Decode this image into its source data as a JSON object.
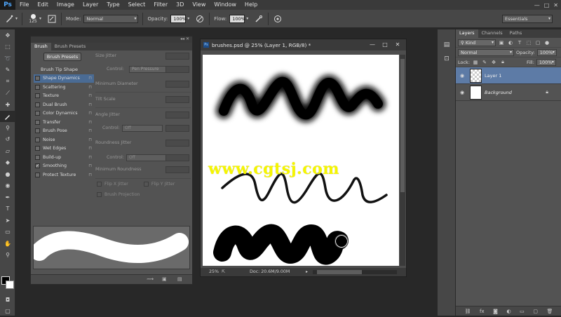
{
  "app": {
    "logo": "Ps"
  },
  "menu": [
    "File",
    "Edit",
    "Image",
    "Layer",
    "Type",
    "Select",
    "Filter",
    "3D",
    "View",
    "Window",
    "Help"
  ],
  "window_controls": [
    "—",
    "□",
    "✕"
  ],
  "options": {
    "brush_size": "125",
    "mode_label": "Mode:",
    "mode_value": "Normal",
    "opacity_label": "Opacity:",
    "opacity_value": "100%",
    "flow_label": "Flow:",
    "flow_value": "100%",
    "workspace": "Essentials"
  },
  "brush_panel": {
    "tabs": [
      "Brush",
      "Brush Presets"
    ],
    "presets_button": "Brush Presets",
    "tip_shape": "Brush Tip Shape",
    "items": [
      {
        "label": "Shape Dynamics",
        "checked": false,
        "selected": true
      },
      {
        "label": "Scattering",
        "checked": false,
        "selected": false
      },
      {
        "label": "Texture",
        "checked": false,
        "selected": false
      },
      {
        "label": "Dual Brush",
        "checked": false,
        "selected": false
      },
      {
        "label": "Color Dynamics",
        "checked": false,
        "selected": false
      },
      {
        "label": "Transfer",
        "checked": false,
        "selected": false
      },
      {
        "label": "Brush Pose",
        "checked": false,
        "selected": false
      },
      {
        "label": "Noise",
        "checked": false,
        "selected": false
      },
      {
        "label": "Wet Edges",
        "checked": false,
        "selected": false
      },
      {
        "label": "Build-up",
        "checked": false,
        "selected": false
      },
      {
        "label": "Smoothing",
        "checked": true,
        "selected": false
      },
      {
        "label": "Protect Texture",
        "checked": false,
        "selected": false
      }
    ],
    "size_jitter": "Size Jitter",
    "control_label": "Control:",
    "control_pen": "Pen Pressure",
    "min_diameter": "Minimum Diameter",
    "tilt_scale": "Tilt Scale",
    "angle_jitter": "Angle Jitter",
    "control_off": "Off",
    "roundness_jitter": "Roundness Jitter",
    "min_roundness": "Minimum Roundness",
    "flip_x": "Flip X Jitter",
    "flip_y": "Flip Y Jitter",
    "brush_projection": "Brush Projection"
  },
  "document": {
    "title": "brushes.psd @ 25% (Layer 1, RGB/8) *",
    "zoom": "25%",
    "doc_size": "Doc: 20.6M/9.00M",
    "watermark": "www.cgtsj.com"
  },
  "layers_panel": {
    "tabs": [
      "Layers",
      "Channels",
      "Paths"
    ],
    "filter": "Kind",
    "blend_mode": "Normal",
    "opacity_label": "Opacity:",
    "opacity_value": "100%",
    "lock_label": "Lock:",
    "fill_label": "Fill:",
    "fill_value": "100%",
    "layers": [
      {
        "name": "Layer 1",
        "selected": true,
        "italic": false
      },
      {
        "name": "Background",
        "selected": false,
        "italic": true
      }
    ]
  },
  "colors": {
    "accent": "#4a6b94",
    "layer_selected": "#5d7ba6",
    "watermark": "#f6f600"
  }
}
